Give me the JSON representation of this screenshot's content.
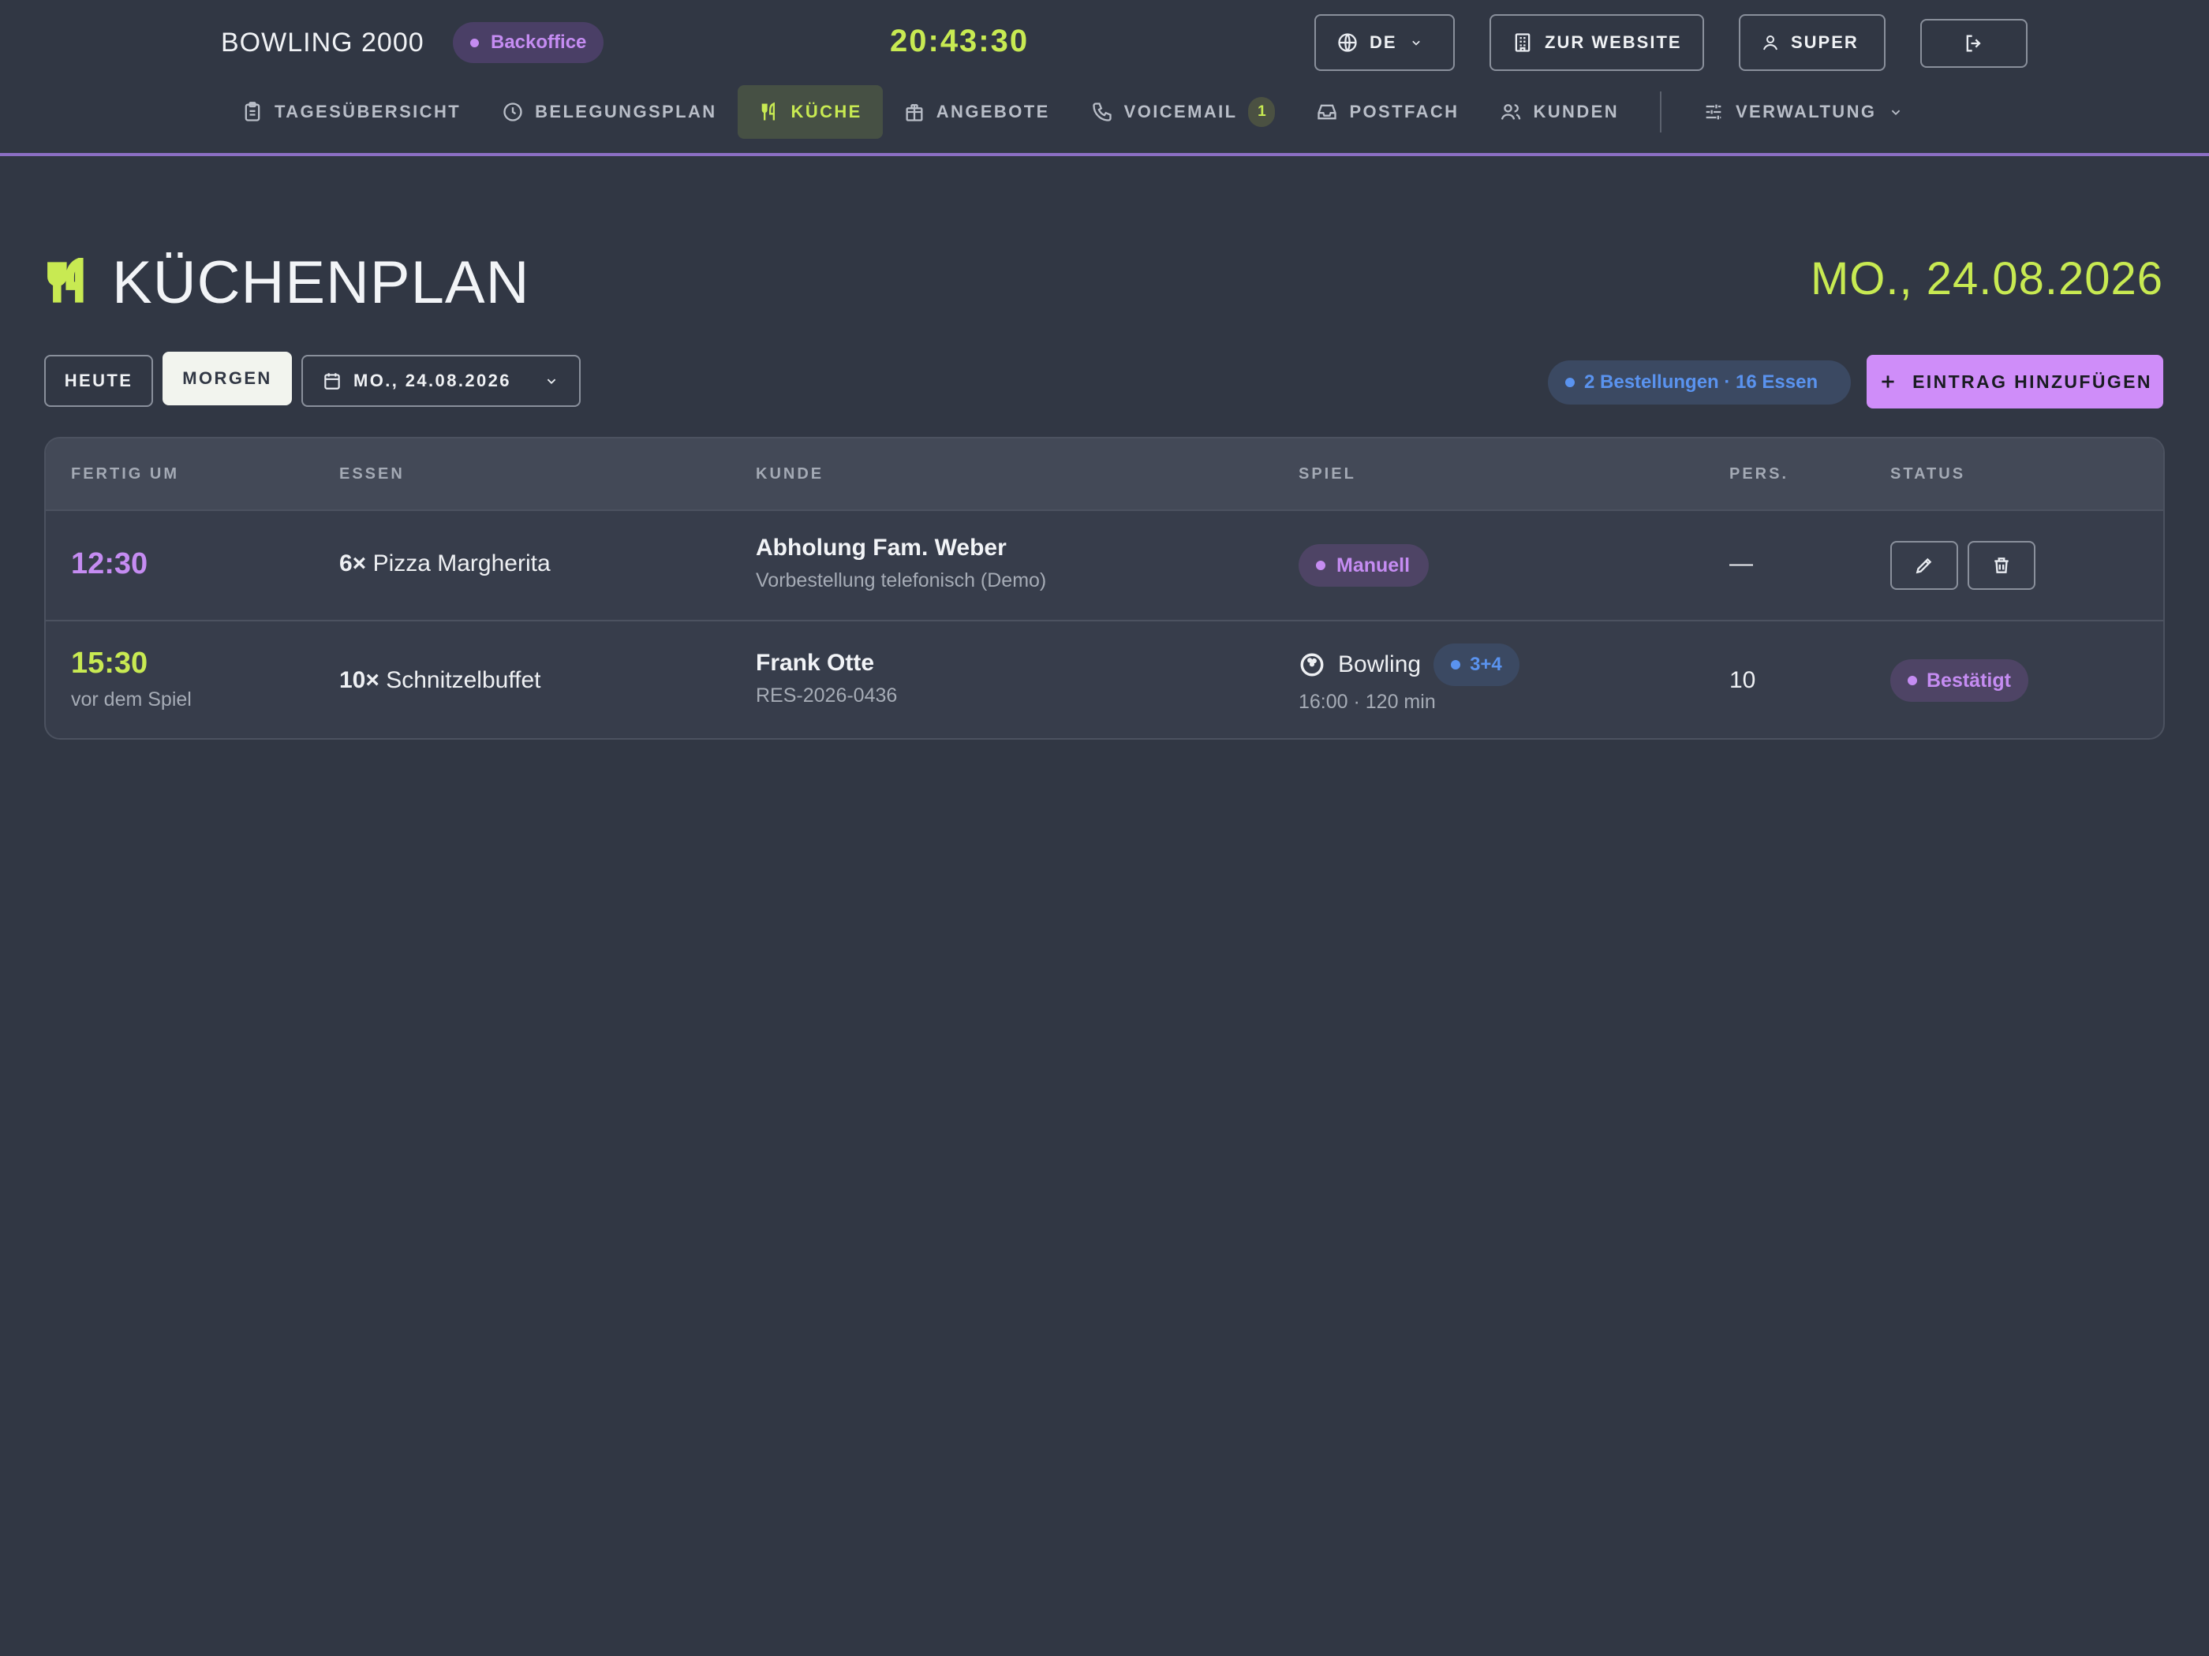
{
  "header": {
    "brand": "BOWLING 2000",
    "badge": "Backoffice",
    "clock": "20:43:30",
    "language": "DE",
    "website_label": "ZUR WEBSITE",
    "user_label": "SUPER"
  },
  "nav": {
    "items": [
      {
        "label": "TAGESÜBERSICHT",
        "icon": "clipboard-icon"
      },
      {
        "label": "BELEGUNGSPLAN",
        "icon": "clock-icon"
      },
      {
        "label": "KÜCHE",
        "icon": "utensils-icon",
        "active": true
      },
      {
        "label": "ANGEBOTE",
        "icon": "gift-icon"
      },
      {
        "label": "VOICEMAIL",
        "icon": "phone-icon",
        "badge": "1"
      },
      {
        "label": "POSTFACH",
        "icon": "inbox-icon"
      },
      {
        "label": "KUNDEN",
        "icon": "users-icon"
      }
    ],
    "admin_label": "VERWALTUNG"
  },
  "page": {
    "title": "KÜCHENPLAN",
    "date": "MO., 24.08.2026"
  },
  "toolbar": {
    "today_label": "HEUTE",
    "tomorrow_label": "MORGEN",
    "date_select": "MO., 24.08.2026",
    "summary": "2 Bestellungen · 16 Essen",
    "add_label": "EINTRAG HINZUFÜGEN"
  },
  "table": {
    "headers": [
      "FERTIG UM",
      "ESSEN",
      "KUNDE",
      "SPIEL",
      "PERS.",
      "STATUS"
    ],
    "rows": [
      {
        "time": "12:30",
        "time_note": "",
        "qty": "6×",
        "meal": "Pizza Margherita",
        "customer": "Abholung Fam. Weber",
        "customer_note": "Vorbestellung telefonisch (Demo)",
        "game_tag": "Manuell",
        "persons": "—"
      },
      {
        "time": "15:30",
        "time_note": "vor dem Spiel",
        "qty": "10×",
        "meal": "Schnitzelbuffet",
        "customer": "Frank Otte",
        "customer_note": "RES-2026-0436",
        "game": "Bowling",
        "lanes": "3+4",
        "game_time": "16:00 · 120 min",
        "persons": "10",
        "status": "Bestätigt"
      }
    ]
  },
  "colors": {
    "background": "#313744",
    "accent_lime": "#c8ea52",
    "accent_purple": "#cf8df9",
    "accent_blue": "#5a93ef"
  }
}
